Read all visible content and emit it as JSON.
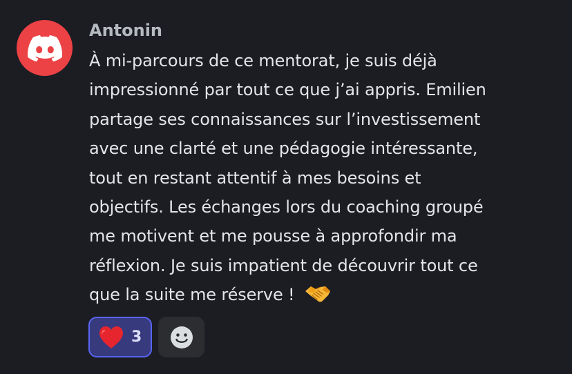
{
  "message": {
    "author": "Antonin",
    "lines": [
      "À mi-parcours de ce mentorat, je suis déjà",
      "impressionné par tout ce que j’ai appris. Emilien",
      "partage ses connaissances sur l’investissement",
      "avec une clarté et une pédagogie intéressante,",
      "tout en restant attentif à mes besoins et",
      "objectifs. Les échanges lors du coaching groupé",
      "me motivent et me pousse à approfondir ma",
      "réflexion. Je suis impatient de découvrir tout ce",
      "que la suite me réserve ! "
    ],
    "trailing_emoji": "handshake-emoji"
  },
  "avatar": {
    "icon": "discord-logo-icon",
    "background": "#ec4245"
  },
  "reactions": [
    {
      "emoji": "red-heart-emoji",
      "count": "3"
    }
  ],
  "add_reaction": {
    "icon": "smiley-face-icon"
  },
  "colors": {
    "background": "#1c1d23",
    "username": "#b5bac1",
    "text": "#e3e5e8",
    "reaction_active_bg": "#383a7e",
    "reaction_active_border": "#5865f2",
    "add_reaction_bg": "#2b2d31"
  }
}
